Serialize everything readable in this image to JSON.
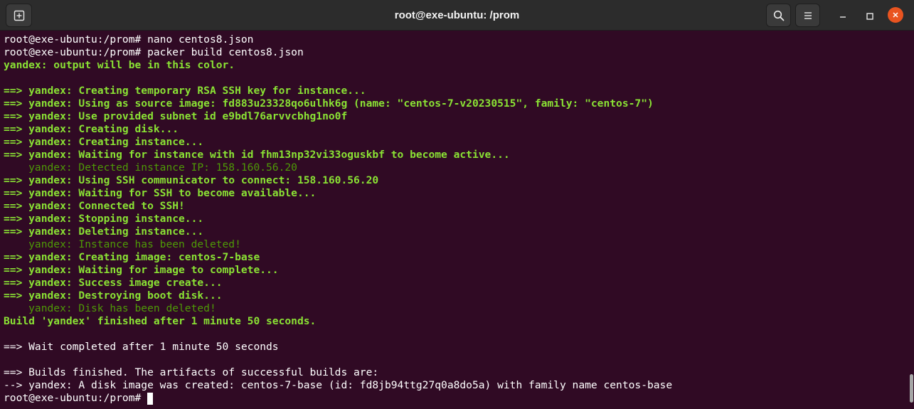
{
  "window": {
    "title": "root@exe-ubuntu: /prom"
  },
  "icons": {
    "new_tab": "new-tab-icon",
    "search": "search-icon",
    "menu": "hamburger-menu-icon",
    "minimize": "minimize-icon",
    "maximize": "maximize-icon",
    "close": "close-icon"
  },
  "colors": {
    "background": "#300a24",
    "titlebar": "#2c2c2c",
    "output_green": "#8ae234",
    "output_dim_green": "#4e9a06",
    "close_button": "#e95420"
  },
  "terminal": {
    "lines": [
      "root@exe-ubuntu:/prom# nano centos8.json",
      "root@exe-ubuntu:/prom# packer build centos8.json",
      "yandex: output will be in this color.",
      "",
      "==> yandex: Creating temporary RSA SSH key for instance...",
      "==> yandex: Using as source image: fd883u23328qo6ulhk6g (name: \"centos-7-v20230515\", family: \"centos-7\")",
      "==> yandex: Use provided subnet id e9bdl76arvvcbhg1no0f",
      "==> yandex: Creating disk...",
      "==> yandex: Creating instance...",
      "==> yandex: Waiting for instance with id fhm13np32vi33oguskbf to become active...",
      "    yandex: Detected instance IP: 158.160.56.20",
      "==> yandex: Using SSH communicator to connect: 158.160.56.20",
      "==> yandex: Waiting for SSH to become available...",
      "==> yandex: Connected to SSH!",
      "==> yandex: Stopping instance...",
      "==> yandex: Deleting instance...",
      "    yandex: Instance has been deleted!",
      "==> yandex: Creating image: centos-7-base",
      "==> yandex: Waiting for image to complete...",
      "==> yandex: Success image create...",
      "==> yandex: Destroying boot disk...",
      "    yandex: Disk has been deleted!",
      "Build 'yandex' finished after 1 minute 50 seconds.",
      "",
      "==> Wait completed after 1 minute 50 seconds",
      "",
      "==> Builds finished. The artifacts of successful builds are:",
      "--> yandex: A disk image was created: centos-7-base (id: fd8jb94ttg27q0a8do5a) with family name centos-base",
      "root@exe-ubuntu:/prom# "
    ]
  }
}
